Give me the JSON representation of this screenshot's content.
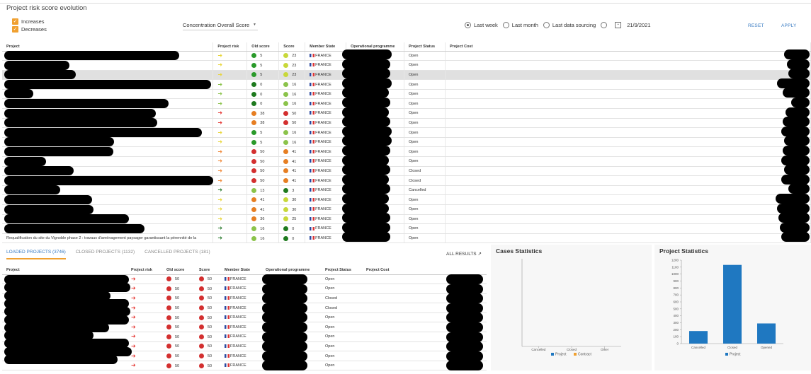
{
  "header": {
    "title": "Project risk score evolution",
    "filters": {
      "increases": "Increases",
      "decreases": "Decreases"
    },
    "dropdown": "Concentration Overall Score",
    "radios": [
      "Last week",
      "Last month",
      "Last data sourcing",
      ""
    ],
    "date": "21/9/2021",
    "reset": "RESET",
    "apply": "APPLY"
  },
  "table1": {
    "columns": [
      "Project",
      "Project risk",
      "Old score",
      "Score",
      "Member State",
      "Operational programme",
      "Project Status",
      "Project Cost"
    ],
    "rows": [
      {
        "risk": "#e8d53a",
        "old": "5",
        "oldc": "#2a9a2a",
        "score": "23",
        "sc": "#c8d83a",
        "ms": "FRANCE",
        "status": "Open"
      },
      {
        "risk": "#e8d53a",
        "old": "5",
        "oldc": "#2a9a2a",
        "score": "23",
        "sc": "#c8d83a",
        "ms": "FRANCE",
        "status": "Open"
      },
      {
        "risk": "#e8d53a",
        "old": "5",
        "oldc": "#2a9a2a",
        "score": "23",
        "sc": "#c8d83a",
        "ms": "FRANCE",
        "status": "Open"
      },
      {
        "risk": "#8bc34a",
        "old": "0",
        "oldc": "#1e7a1e",
        "score": "16",
        "sc": "#8bc34a",
        "ms": "FRANCE",
        "status": "Open"
      },
      {
        "risk": "#8bc34a",
        "old": "0",
        "oldc": "#1e7a1e",
        "score": "16",
        "sc": "#8bc34a",
        "ms": "FRANCE",
        "status": "Open"
      },
      {
        "risk": "#8bc34a",
        "old": "0",
        "oldc": "#1e7a1e",
        "score": "16",
        "sc": "#8bc34a",
        "ms": "FRANCE",
        "status": "Open"
      },
      {
        "risk": "#e53935",
        "old": "38",
        "oldc": "#e67e22",
        "score": "50",
        "sc": "#d32f2f",
        "ms": "FRANCE",
        "status": "Open"
      },
      {
        "risk": "#e53935",
        "old": "38",
        "oldc": "#e67e22",
        "score": "50",
        "sc": "#d32f2f",
        "ms": "FRANCE",
        "status": "Open"
      },
      {
        "risk": "#e8d53a",
        "old": "5",
        "oldc": "#2a9a2a",
        "score": "16",
        "sc": "#8bc34a",
        "ms": "FRANCE",
        "status": "Open"
      },
      {
        "risk": "#e8d53a",
        "old": "5",
        "oldc": "#2a9a2a",
        "score": "16",
        "sc": "#8bc34a",
        "ms": "FRANCE",
        "status": "Open"
      },
      {
        "risk": "#f08a3a",
        "old": "50",
        "oldc": "#d32f2f",
        "score": "41",
        "sc": "#e67e22",
        "ms": "FRANCE",
        "status": "Open"
      },
      {
        "risk": "#f08a3a",
        "old": "50",
        "oldc": "#d32f2f",
        "score": "41",
        "sc": "#e67e22",
        "ms": "FRANCE",
        "status": "Open"
      },
      {
        "risk": "#f08a3a",
        "old": "50",
        "oldc": "#d32f2f",
        "score": "41",
        "sc": "#e67e22",
        "ms": "FRANCE",
        "status": "Closed"
      },
      {
        "risk": "#f08a3a",
        "old": "50",
        "oldc": "#d32f2f",
        "score": "41",
        "sc": "#e67e22",
        "ms": "FRANCE",
        "status": "Closed"
      },
      {
        "risk": "#2e7d32",
        "old": "13",
        "oldc": "#8bc34a",
        "score": "3",
        "sc": "#1e7a1e",
        "ms": "FRANCE",
        "status": "Cancelled"
      },
      {
        "risk": "#e8d53a",
        "old": "41",
        "oldc": "#e67e22",
        "score": "30",
        "sc": "#c8d83a",
        "ms": "FRANCE",
        "status": "Open"
      },
      {
        "risk": "#e8d53a",
        "old": "41",
        "oldc": "#e67e22",
        "score": "30",
        "sc": "#c8d83a",
        "ms": "FRANCE",
        "status": "Open"
      },
      {
        "risk": "#e8d53a",
        "old": "36",
        "oldc": "#e67e22",
        "score": "25",
        "sc": "#c8d83a",
        "ms": "FRANCE",
        "status": "Open"
      },
      {
        "risk": "#2e7d32",
        "old": "16",
        "oldc": "#8bc34a",
        "score": "0",
        "sc": "#1e7a1e",
        "ms": "FRANCE",
        "status": "Open"
      },
      {
        "risk": "#2e7d32",
        "old": "16",
        "oldc": "#8bc34a",
        "score": "0",
        "sc": "#1e7a1e",
        "ms": "FRANCE",
        "status": "Open"
      }
    ],
    "last_row_project": "Requalification du site du Vignoble phase 2 : travaux d'aménagement paysager garantissant la pérennité de la"
  },
  "tabs": [
    "LOADED PROJECTS (3746)",
    "CLOSED PROJECTS (1132)",
    "CANCELLED PROJECTS (181)"
  ],
  "all_results": "ALL RESULTS",
  "table2": {
    "columns": [
      "Project",
      "Project risk",
      "Old score",
      "Score",
      "Member State",
      "Operational programme",
      "Project Status",
      "Project Cost"
    ],
    "rows": [
      {
        "old": "50",
        "score": "50",
        "ms": "FRANCE",
        "status": "Open"
      },
      {
        "old": "50",
        "score": "50",
        "ms": "FRANCE",
        "status": "Open"
      },
      {
        "old": "50",
        "score": "50",
        "ms": "FRANCE",
        "status": "Closed"
      },
      {
        "old": "50",
        "score": "50",
        "ms": "FRANCE",
        "status": "Closed"
      },
      {
        "old": "50",
        "score": "50",
        "ms": "FRANCE",
        "status": "Open"
      },
      {
        "old": "50",
        "score": "50",
        "ms": "FRANCE",
        "status": "Open"
      },
      {
        "old": "50",
        "score": "50",
        "ms": "FRANCE",
        "status": "Open"
      },
      {
        "old": "50",
        "score": "50",
        "ms": "FRANCE",
        "status": "Open"
      },
      {
        "old": "50",
        "score": "50",
        "ms": "FRANCE",
        "status": "Open"
      },
      {
        "old": "50",
        "score": "50",
        "ms": "FRANCE",
        "status": "Open"
      }
    ]
  },
  "chart_data": [
    {
      "type": "bar",
      "title": "Cases Statistics",
      "categories": [
        "Cancelled",
        "Closed",
        "Other"
      ],
      "series": [
        {
          "name": "Project",
          "values": [
            0,
            0,
            0
          ]
        },
        {
          "name": "Contract",
          "values": [
            0,
            0,
            0
          ]
        }
      ],
      "colors": [
        "#1f78c1",
        "#f0a030"
      ]
    },
    {
      "type": "bar",
      "title": "Project Statistics",
      "categories": [
        "Cancelled",
        "Closed",
        "Opened"
      ],
      "series": [
        {
          "name": "Project",
          "values": [
            181,
            1132,
            290
          ]
        }
      ],
      "yticks": [
        0,
        100,
        200,
        300,
        400,
        500,
        600,
        700,
        800,
        900,
        1000,
        1100,
        1200
      ],
      "ylim": [
        0,
        1200
      ],
      "colors": [
        "#1f78c1"
      ]
    }
  ]
}
